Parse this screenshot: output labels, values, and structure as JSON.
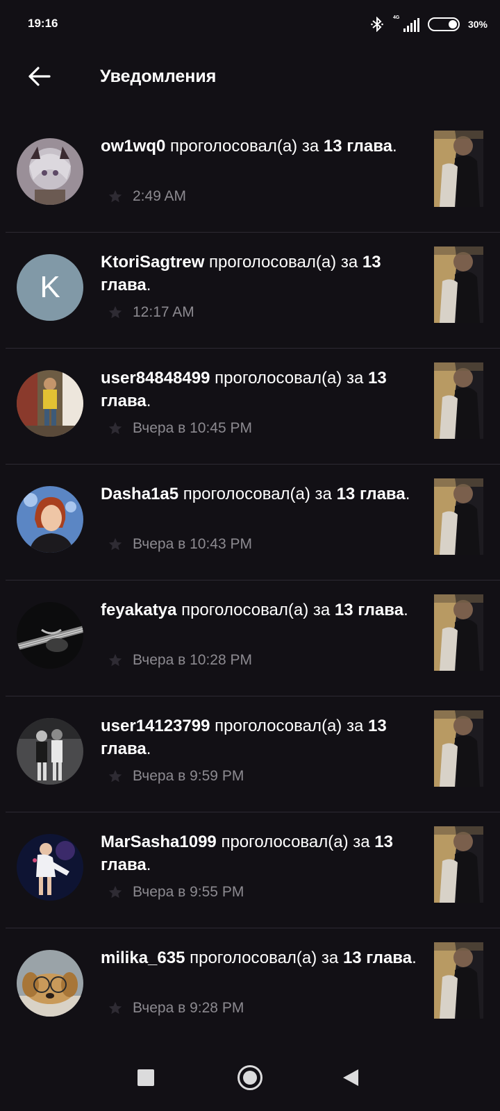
{
  "status_bar": {
    "time": "19:16",
    "network": "4G",
    "battery": "30%",
    "icons": [
      "bluetooth-icon",
      "signal-icon",
      "battery-icon"
    ]
  },
  "header": {
    "title": "Уведомления",
    "back_icon": "arrow-left-icon"
  },
  "notifications": [
    {
      "user": "ow1wq0",
      "action": " проголосовал(а) за ",
      "target": "13 глава",
      "suffix": ".",
      "time": "2:49 AM",
      "avatar": "photo"
    },
    {
      "user": "KtoriSagtrew",
      "action": " проголосовал(а) за ",
      "target": "13 глава",
      "suffix": ".",
      "time": "12:17 AM",
      "avatar": "letter",
      "avatar_letter": "K"
    },
    {
      "user": "user84848499",
      "action": " проголосовал(а) за ",
      "target": "13 глава",
      "suffix": ".",
      "time": "Вчера в 10:45 PM",
      "avatar": "photo"
    },
    {
      "user": "Dasha1a5",
      "action": " проголосовал(а) за ",
      "target": "13 глава",
      "suffix": ".",
      "time": "Вчера в 10:43 PM",
      "avatar": "photo"
    },
    {
      "user": "feyakatya",
      "action": " проголосовал(а) за ",
      "target": "13 глава",
      "suffix": ".",
      "time": "Вчера в 10:28 PM",
      "avatar": "photo"
    },
    {
      "user": "user14123799",
      "action": " проголосовал(а) за ",
      "target": "13 глава",
      "suffix": ".",
      "time": "Вчера в 9:59 PM",
      "avatar": "photo"
    },
    {
      "user": "MarSasha1099",
      "action": " проголосовал(а) за ",
      "target": "13 глава",
      "suffix": ".",
      "time": "Вчера в 9:55 PM",
      "avatar": "photo"
    },
    {
      "user": "milika_635",
      "action": " проголосовал(а) за ",
      "target": "13 глава",
      "suffix": ".",
      "time": "Вчера в 9:28 PM",
      "avatar": "photo"
    }
  ],
  "nav_bar": {
    "icons": [
      "recent-apps-icon",
      "home-icon",
      "nav-back-icon"
    ]
  },
  "colors": {
    "background": "#121015",
    "divider": "#2d2a33",
    "secondary_text": "#8c8a90",
    "letter_avatar": "#8199a7"
  }
}
